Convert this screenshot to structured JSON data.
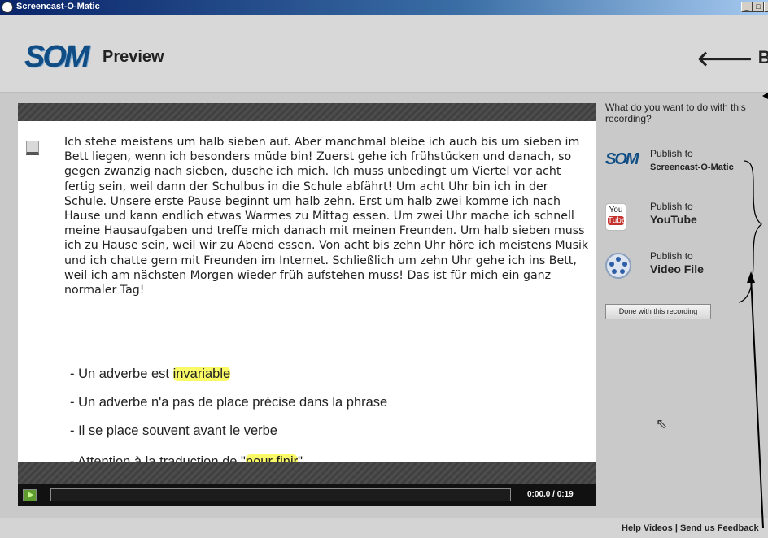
{
  "window": {
    "title": "Screencast-O-Matic",
    "controls": [
      "_",
      "□",
      "x"
    ]
  },
  "header": {
    "logo": "SOM",
    "title": "Preview",
    "back_label": "Back"
  },
  "slide": {
    "paragraph": "Ich stehe meistens um halb sieben auf. Aber manchmal bleibe ich auch bis um sieben im Bett liegen, wenn ich besonders müde bin! Zuerst gehe ich frühstücken und danach, so gegen zwanzig nach sieben, dusche ich mich. Ich muss unbedingt um Viertel vor acht fertig sein, weil dann der Schulbus in die Schule abfährt! Um acht Uhr bin ich in der Schule. Unsere erste Pause beginnt um halb zehn. Erst um halb zwei komme ich nach Hause und kann endlich etwas Warmes zu Mittag essen. Um zwei Uhr mache ich schnell meine Hausaufgaben und treffe mich danach mit meinen Freunden. Um halb sieben muss ich zu Hause sein, weil wir zu Abend essen. Von acht bis zehn Uhr höre ich meistens Musik und ich chatte gern mit Freunden im Internet. Schließlich um zehn Uhr gehe ich ins Bett, weil ich am nächsten Morgen wieder früh aufstehen muss! Das ist für mich ein ganz normaler Tag!",
    "bullet1_pre": "- Un adverbe est ",
    "bullet1_hl": "invariable",
    "bullet2": "- Un adverbe n'a pas de place précise dans la phrase",
    "bullet3": "- Il se place souvent avant le verbe",
    "bullet4_pre": "- Attention à la traduction de \"",
    "bullet4_hl": "pour finir",
    "bullet4_post": "\""
  },
  "player": {
    "time": "0:00.0 / 0:19",
    "progress": 0
  },
  "sidebar": {
    "question": "What do you want to do with this recording?",
    "publish": [
      {
        "line1": "Publish to",
        "line2": "Screencast-O-Matic",
        "icon": "som-logo-icon"
      },
      {
        "line1": "Publish to",
        "line2": "YouTube",
        "icon": "youtube-icon",
        "icon_top": "You",
        "icon_bottom": "Tube"
      },
      {
        "line1": "Publish to",
        "line2": "Video File",
        "icon": "film-reel-icon"
      }
    ],
    "done_label": "Done with this recording"
  },
  "footer": {
    "help": "Help Videos",
    "separator": "|",
    "feedback": "Send us Feedback"
  },
  "colors": {
    "brand": "#0f4d84",
    "highlight": "#fafa66",
    "youtube": "#c4302b",
    "play": "#5e9c2f"
  }
}
